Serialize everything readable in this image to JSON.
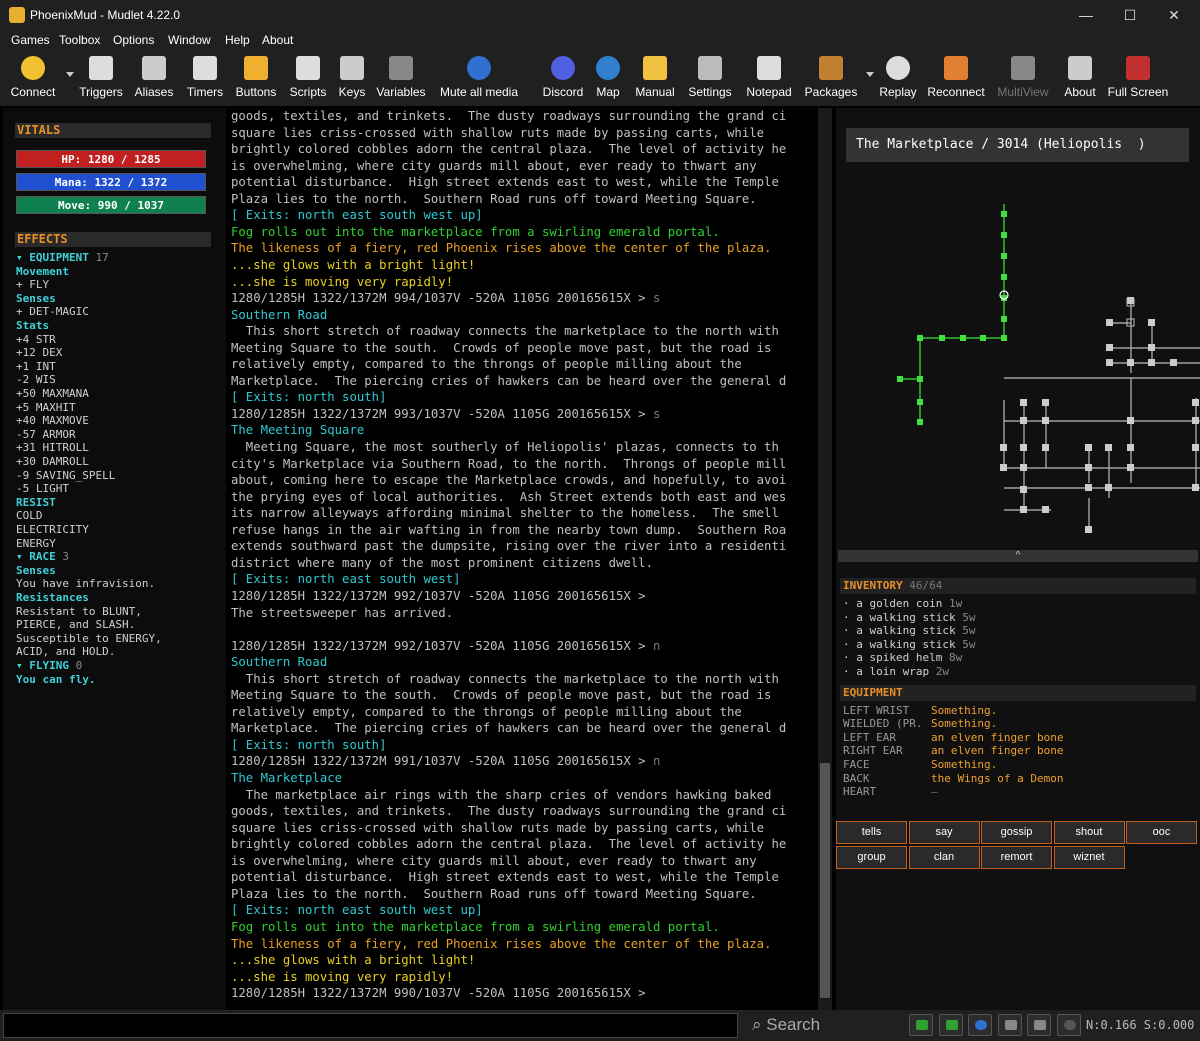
{
  "window": {
    "title": "PhoenixMud - Mudlet 4.22.0",
    "minimize": "—",
    "maximize": "☐",
    "close": "✕"
  },
  "menu": [
    "Games",
    "Toolbox",
    "Options",
    "Window",
    "Help",
    "About"
  ],
  "toolbar": [
    {
      "label": "Connect",
      "icon": "connect-icon"
    },
    {
      "label": "Triggers",
      "icon": "triggers-icon"
    },
    {
      "label": "Aliases",
      "icon": "aliases-icon"
    },
    {
      "label": "Timers",
      "icon": "timers-icon"
    },
    {
      "label": "Buttons",
      "icon": "buttons-icon"
    },
    {
      "label": "Scripts",
      "icon": "scripts-icon"
    },
    {
      "label": "Keys",
      "icon": "keys-icon"
    },
    {
      "label": "Variables",
      "icon": "variables-icon"
    },
    {
      "label": "Mute all media",
      "icon": "mute-media-icon"
    },
    {
      "label": "Discord",
      "icon": "discord-icon"
    },
    {
      "label": "Map",
      "icon": "map-icon"
    },
    {
      "label": "Manual",
      "icon": "manual-icon"
    },
    {
      "label": "Settings",
      "icon": "settings-icon"
    },
    {
      "label": "Notepad",
      "icon": "notepad-icon"
    },
    {
      "label": "Packages",
      "icon": "packages-icon"
    },
    {
      "label": "Replay",
      "icon": "replay-icon"
    },
    {
      "label": "Reconnect",
      "icon": "reconnect-icon"
    },
    {
      "label": "MultiView",
      "icon": "multiview-icon"
    },
    {
      "label": "About",
      "icon": "about-icon"
    },
    {
      "label": "Full Screen",
      "icon": "fullscreen-icon"
    }
  ],
  "vitals": {
    "header": "VITALS",
    "hp": {
      "text": "HP: 1280 / 1285",
      "color": "#c02020"
    },
    "mana": {
      "text": "Mana: 1322 / 1372",
      "color": "#2050d0"
    },
    "move": {
      "text": "Move: 990 / 1037",
      "color": "#108050"
    }
  },
  "effects": {
    "header": "EFFECTS",
    "lines": [
      {
        "text": "▾ EQUIPMENT",
        "count": "17",
        "kind": "hdr"
      },
      {
        "text": "Movement",
        "kind": "grp"
      },
      {
        "text": "  + FLY",
        "kind": "sub"
      },
      {
        "text": "Senses",
        "kind": "grp"
      },
      {
        "text": "  + DET-MAGIC",
        "kind": "sub"
      },
      {
        "text": "Stats",
        "kind": "grp"
      },
      {
        "text": "  +4 STR",
        "kind": "sub"
      },
      {
        "text": "  +12 DEX",
        "kind": "sub"
      },
      {
        "text": "  +1 INT",
        "kind": "sub"
      },
      {
        "text": "  -2 WIS",
        "kind": "sub"
      },
      {
        "text": "  +50 MAXMANA",
        "kind": "sub"
      },
      {
        "text": "  +5 MAXHIT",
        "kind": "sub"
      },
      {
        "text": "  +40 MAXMOVE",
        "kind": "sub"
      },
      {
        "text": "  -57 ARMOR",
        "kind": "sub"
      },
      {
        "text": "  +31 HITROLL",
        "kind": "sub"
      },
      {
        "text": "  +30 DAMROLL",
        "kind": "sub"
      },
      {
        "text": "  -9 SAVING_SPELL",
        "kind": "sub"
      },
      {
        "text": "  -5 LIGHT",
        "kind": "sub"
      },
      {
        "text": "RESIST",
        "kind": "grp"
      },
      {
        "text": "  COLD",
        "kind": "sub"
      },
      {
        "text": "  ELECTRICITY",
        "kind": "sub"
      },
      {
        "text": "  ENERGY",
        "kind": "sub"
      },
      {
        "text": "▾ RACE",
        "count": "3",
        "kind": "hdr"
      },
      {
        "text": "Senses",
        "kind": "grp"
      },
      {
        "text": "  You have infravision.",
        "kind": "sub"
      },
      {
        "text": "Resistances",
        "kind": "grp"
      },
      {
        "text": "  Resistant to BLUNT,",
        "kind": "sub"
      },
      {
        "text": "PIERCE, and SLASH.",
        "kind": "sub"
      },
      {
        "text": "  Susceptible to ENERGY,",
        "kind": "sub"
      },
      {
        "text": "ACID, and HOLD.",
        "kind": "sub"
      },
      {
        "text": "▾ FLYING",
        "count": "0",
        "kind": "hdr"
      },
      {
        "text": "You can fly.",
        "kind": "grp"
      }
    ]
  },
  "output": [
    {
      "t": "goods, textiles, and trinkets.  The dusty roadways surrounding the grand ci",
      "c": "#c0c0c0"
    },
    {
      "t": "square lies criss-crossed with shallow ruts made by passing carts, while",
      "c": "#c0c0c0"
    },
    {
      "t": "brightly colored cobbles adorn the central plaza.  The level of activity he",
      "c": "#c0c0c0"
    },
    {
      "t": "is overwhelming, where city guards mill about, ever ready to thwart any",
      "c": "#c0c0c0"
    },
    {
      "t": "potential disturbance.  High street extends east to west, while the Temple",
      "c": "#c0c0c0"
    },
    {
      "t": "Plaza lies to the north.  Southern Road runs off toward Meeting Square.",
      "c": "#c0c0c0"
    },
    {
      "t": "[ Exits: north east south west up]",
      "c": "#30c8d0"
    },
    {
      "t": "Fog rolls out into the marketplace from a swirling emerald portal.",
      "c": "#30d030"
    },
    {
      "t": "The likeness of a fiery, red Phoenix rises above the center of the plaza.",
      "c": "#e8a020"
    },
    {
      "t": "...she glows with a bright light!",
      "c": "#e8d020"
    },
    {
      "t": "...she is moving very rapidly!",
      "c": "#e8d020"
    },
    {
      "t": "1280/1285H 1322/1372M 994/1037V -520A 1105G 200165615X > ",
      "c": "#c0c0c0",
      "cmd": "s"
    },
    {
      "t": "Southern Road",
      "c": "#30c8d0"
    },
    {
      "t": "  This short stretch of roadway connects the marketplace to the north with",
      "c": "#c0c0c0"
    },
    {
      "t": "Meeting Square to the south.  Crowds of people move past, but the road is",
      "c": "#c0c0c0"
    },
    {
      "t": "relatively empty, compared to the throngs of people milling about the",
      "c": "#c0c0c0"
    },
    {
      "t": "Marketplace.  The piercing cries of hawkers can be heard over the general d",
      "c": "#c0c0c0"
    },
    {
      "t": "[ Exits: north south]",
      "c": "#30c8d0"
    },
    {
      "t": "1280/1285H 1322/1372M 993/1037V -520A 1105G 200165615X > ",
      "c": "#c0c0c0",
      "cmd": "s"
    },
    {
      "t": "The Meeting Square",
      "c": "#30c8d0"
    },
    {
      "t": "  Meeting Square, the most southerly of Heliopolis' plazas, connects to th",
      "c": "#c0c0c0"
    },
    {
      "t": "city's Marketplace via Southern Road, to the north.  Throngs of people mill",
      "c": "#c0c0c0"
    },
    {
      "t": "about, coming here to escape the Marketplace crowds, and hopefully, to avoi",
      "c": "#c0c0c0"
    },
    {
      "t": "the prying eyes of local authorities.  Ash Street extends both east and wes",
      "c": "#c0c0c0"
    },
    {
      "t": "its narrow alleyways affording minimal shelter to the homeless.  The smell",
      "c": "#c0c0c0"
    },
    {
      "t": "refuse hangs in the air wafting in from the nearby town dump.  Southern Roa",
      "c": "#c0c0c0"
    },
    {
      "t": "extends southward past the dumpsite, rising over the river into a residenti",
      "c": "#c0c0c0"
    },
    {
      "t": "district where many of the most prominent citizens dwell.",
      "c": "#c0c0c0"
    },
    {
      "t": "[ Exits: north east south west]",
      "c": "#30c8d0"
    },
    {
      "t": "1280/1285H 1322/1372M 992/1037V -520A 1105G 200165615X > ",
      "c": "#c0c0c0"
    },
    {
      "t": "The streetsweeper has arrived.",
      "c": "#c0c0c0"
    },
    {
      "t": "",
      "c": "#c0c0c0"
    },
    {
      "t": "1280/1285H 1322/1372M 992/1037V -520A 1105G 200165615X > ",
      "c": "#c0c0c0",
      "cmd": "n"
    },
    {
      "t": "Southern Road",
      "c": "#30c8d0"
    },
    {
      "t": "  This short stretch of roadway connects the marketplace to the north with",
      "c": "#c0c0c0"
    },
    {
      "t": "Meeting Square to the south.  Crowds of people move past, but the road is",
      "c": "#c0c0c0"
    },
    {
      "t": "relatively empty, compared to the throngs of people milling about the",
      "c": "#c0c0c0"
    },
    {
      "t": "Marketplace.  The piercing cries of hawkers can be heard over the general d",
      "c": "#c0c0c0"
    },
    {
      "t": "[ Exits: north south]",
      "c": "#30c8d0"
    },
    {
      "t": "1280/1285H 1322/1372M 991/1037V -520A 1105G 200165615X > ",
      "c": "#c0c0c0",
      "cmd": "n"
    },
    {
      "t": "The Marketplace",
      "c": "#30c8d0"
    },
    {
      "t": "  The marketplace air rings with the sharp cries of vendors hawking baked",
      "c": "#c0c0c0"
    },
    {
      "t": "goods, textiles, and trinkets.  The dusty roadways surrounding the grand ci",
      "c": "#c0c0c0"
    },
    {
      "t": "square lies criss-crossed with shallow ruts made by passing carts, while",
      "c": "#c0c0c0"
    },
    {
      "t": "brightly colored cobbles adorn the central plaza.  The level of activity he",
      "c": "#c0c0c0"
    },
    {
      "t": "is overwhelming, where city guards mill about, ever ready to thwart any",
      "c": "#c0c0c0"
    },
    {
      "t": "potential disturbance.  High street extends east to west, while the Temple",
      "c": "#c0c0c0"
    },
    {
      "t": "Plaza lies to the north.  Southern Road runs off toward Meeting Square.",
      "c": "#c0c0c0"
    },
    {
      "t": "[ Exits: north east south west up]",
      "c": "#30c8d0"
    },
    {
      "t": "Fog rolls out into the marketplace from a swirling emerald portal.",
      "c": "#30d030"
    },
    {
      "t": "The likeness of a fiery, red Phoenix rises above the center of the plaza.",
      "c": "#e8a020"
    },
    {
      "t": "...she glows with a bright light!",
      "c": "#e8d020"
    },
    {
      "t": "...she is moving very rapidly!",
      "c": "#e8d020"
    },
    {
      "t": "1280/1285H 1322/1372M 990/1037V -520A 1105G 200165615X > ",
      "c": "#c0c0c0"
    }
  ],
  "map": {
    "title": "The Marketplace / 3014 (Heliopolis  )",
    "collapse": "^"
  },
  "inventory": {
    "header": "INVENTORY",
    "count": "46/64",
    "items": [
      {
        "name": "· a golden coin",
        "weight": "1w"
      },
      {
        "name": "· a walking stick",
        "weight": "5w"
      },
      {
        "name": "· a walking stick",
        "weight": "5w"
      },
      {
        "name": "· a walking stick",
        "weight": "5w"
      },
      {
        "name": "· a spiked helm",
        "weight": "8w"
      },
      {
        "name": "· a loin wrap",
        "weight": "2w"
      }
    ]
  },
  "equipment": {
    "header": "EQUIPMENT",
    "slots": [
      {
        "slot": "LEFT WRIST",
        "item": "Something."
      },
      {
        "slot": "WIELDED (PR.",
        "item": "Something."
      },
      {
        "slot": "LEFT EAR",
        "item": "an elven finger bone"
      },
      {
        "slot": "RIGHT EAR",
        "item": "an elven finger bone"
      },
      {
        "slot": "FACE",
        "item": "Something."
      },
      {
        "slot": "BACK",
        "item": "the Wings of a Demon"
      },
      {
        "slot": "HEART",
        "item": "—"
      }
    ]
  },
  "channels": [
    "tells",
    "say",
    "gossip",
    "shout",
    "ooc",
    "group",
    "clan",
    "remort",
    "wiznet"
  ],
  "input": {
    "value": "",
    "search": "Search",
    "netstat": "N:0.166 S:0.000"
  },
  "status_icons": [
    "network-icon",
    "connection-icon",
    "info-icon",
    "gamepad-icon",
    "screen-icon",
    "record-icon"
  ]
}
